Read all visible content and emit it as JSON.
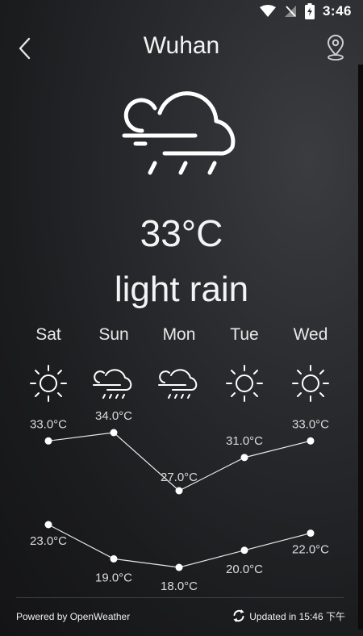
{
  "status_bar": {
    "time": "3:46",
    "icons": [
      "wifi-icon",
      "no-signal-icon",
      "battery-charging-icon"
    ]
  },
  "header": {
    "city": "Wuhan",
    "back_icon": "chevron-left-icon",
    "location_icon": "location-pin-icon"
  },
  "current": {
    "icon": "cloud-rain-icon",
    "temperature": "33°C",
    "description": "light rain"
  },
  "forecast": [
    {
      "day": "Sat",
      "icon": "sun-icon",
      "high": "33.0°C",
      "low": "23.0°C"
    },
    {
      "day": "Sun",
      "icon": "cloud-rain-icon",
      "high": "34.0°C",
      "low": "19.0°C"
    },
    {
      "day": "Mon",
      "icon": "cloud-rain-icon",
      "high": "27.0°C",
      "low": "18.0°C"
    },
    {
      "day": "Tue",
      "icon": "sun-icon",
      "high": "31.0°C",
      "low": "20.0°C"
    },
    {
      "day": "Wed",
      "icon": "sun-icon",
      "high": "33.0°C",
      "low": "22.0°C"
    }
  ],
  "chart_data": {
    "type": "line",
    "categories": [
      "Sat",
      "Sun",
      "Mon",
      "Tue",
      "Wed"
    ],
    "series": [
      {
        "values": [
          33.0,
          34.0,
          27.0,
          31.0,
          33.0
        ]
      },
      {
        "values": [
          23.0,
          19.0,
          18.0,
          20.0,
          22.0
        ]
      }
    ],
    "unit": "°C",
    "grid": false
  },
  "footer": {
    "powered_by": "Powered by OpenWeather",
    "updated": "Updated in 15:46 下午"
  }
}
